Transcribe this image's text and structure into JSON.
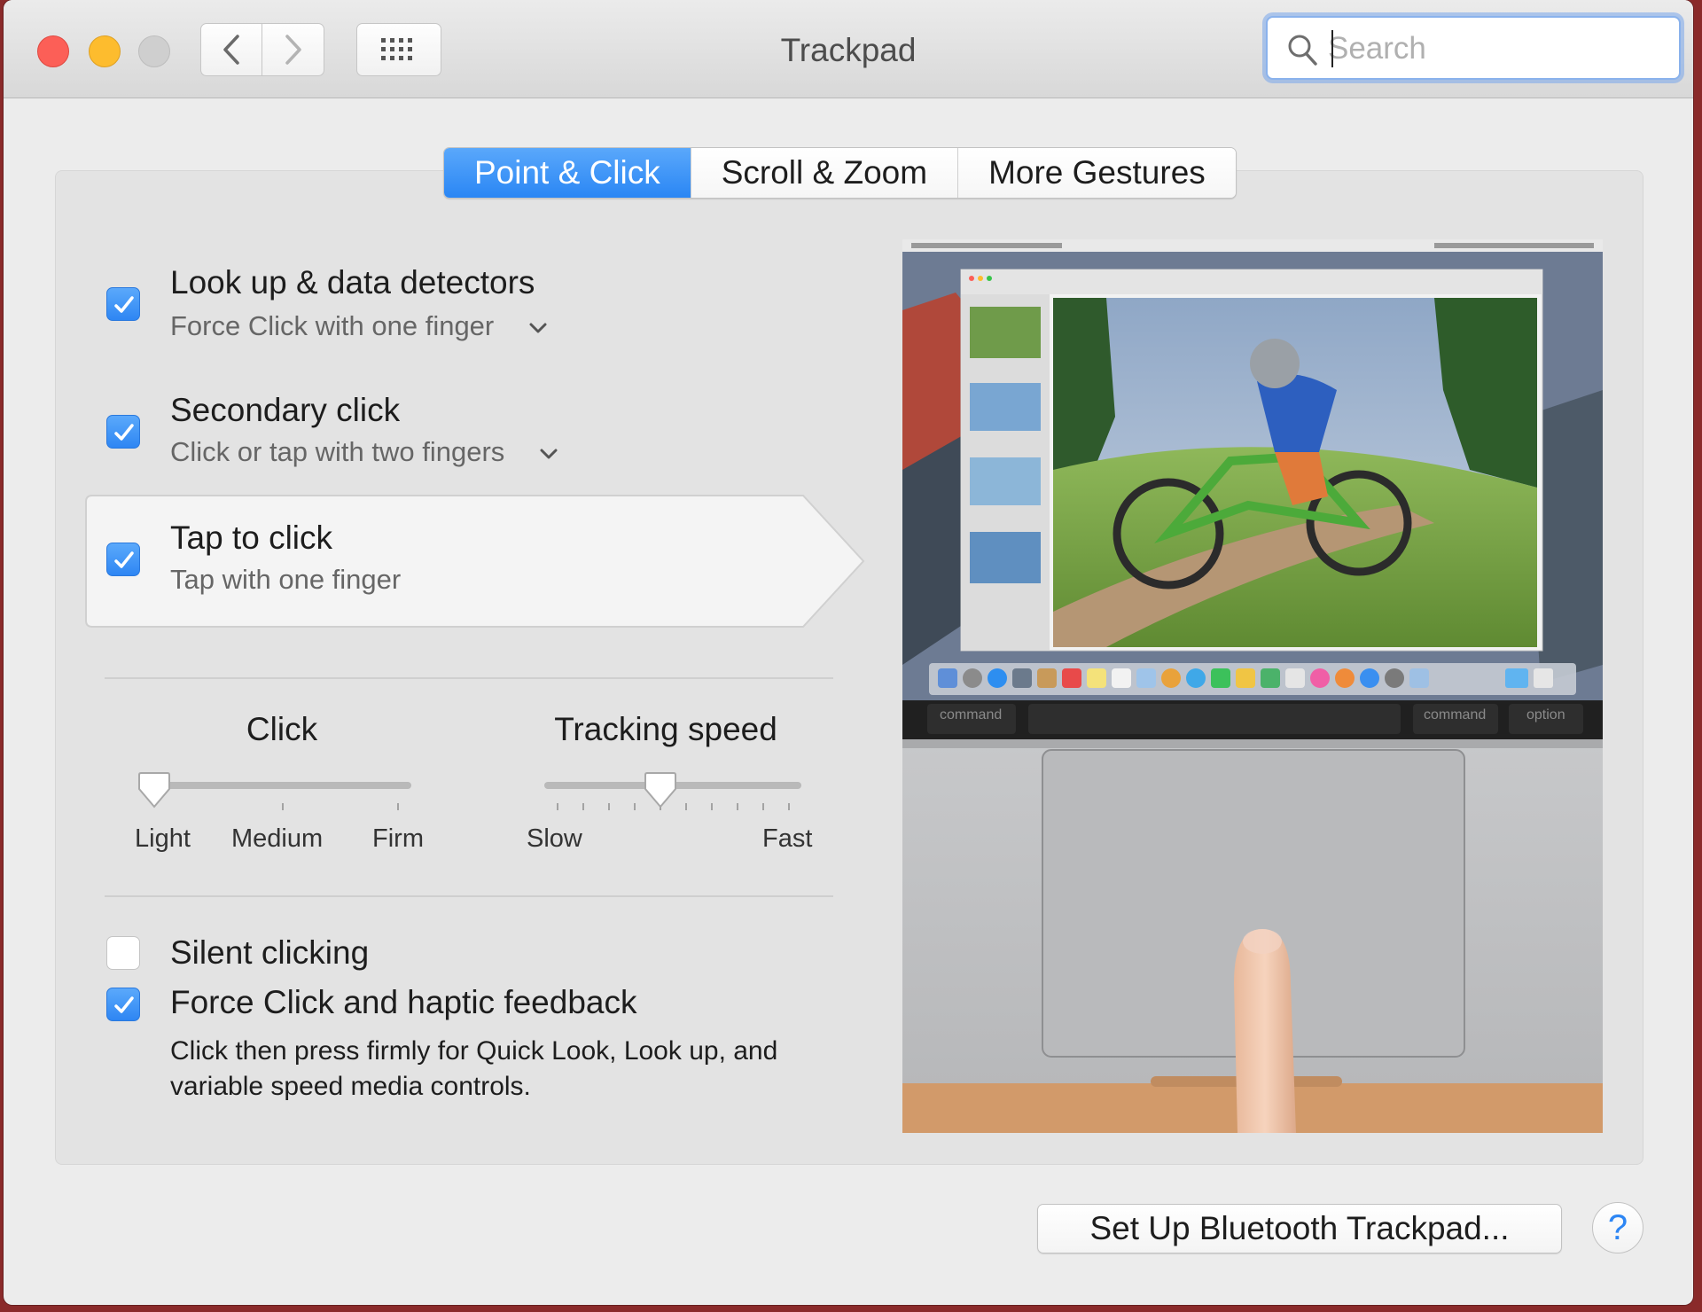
{
  "window": {
    "title": "Trackpad"
  },
  "search": {
    "placeholder": "Search",
    "value": ""
  },
  "tabs": [
    {
      "label": "Point & Click",
      "active": true
    },
    {
      "label": "Scroll & Zoom",
      "active": false
    },
    {
      "label": "More Gestures",
      "active": false
    }
  ],
  "options": {
    "lookup": {
      "title": "Look up & data detectors",
      "subtitle": "Force Click with one finger",
      "checked": true
    },
    "secondary": {
      "title": "Secondary click",
      "subtitle": "Click or tap with two fingers",
      "checked": true
    },
    "tap": {
      "title": "Tap to click",
      "subtitle": "Tap with one finger",
      "checked": true
    },
    "silent": {
      "title": "Silent clicking",
      "checked": false
    },
    "force": {
      "title": "Force Click and haptic feedback",
      "checked": true,
      "description": "Click then press firmly for Quick Look, Look up, and variable speed media controls."
    }
  },
  "click_slider": {
    "label": "Click",
    "scale": [
      "Light",
      "Medium",
      "Firm"
    ],
    "value": 0
  },
  "tracking_slider": {
    "label": "Tracking speed",
    "min_label": "Slow",
    "max_label": "Fast",
    "value": 0.45
  },
  "preview": {
    "keys": [
      "command",
      "command",
      "option"
    ]
  },
  "buttons": {
    "setup_bluetooth": "Set Up Bluetooth Trackpad...",
    "help": "?"
  },
  "colors": {
    "accent": "#2a86f4",
    "close": "#fc5f57",
    "minimize": "#fdbc2e",
    "zoom_disabled": "#cfcfcf"
  }
}
